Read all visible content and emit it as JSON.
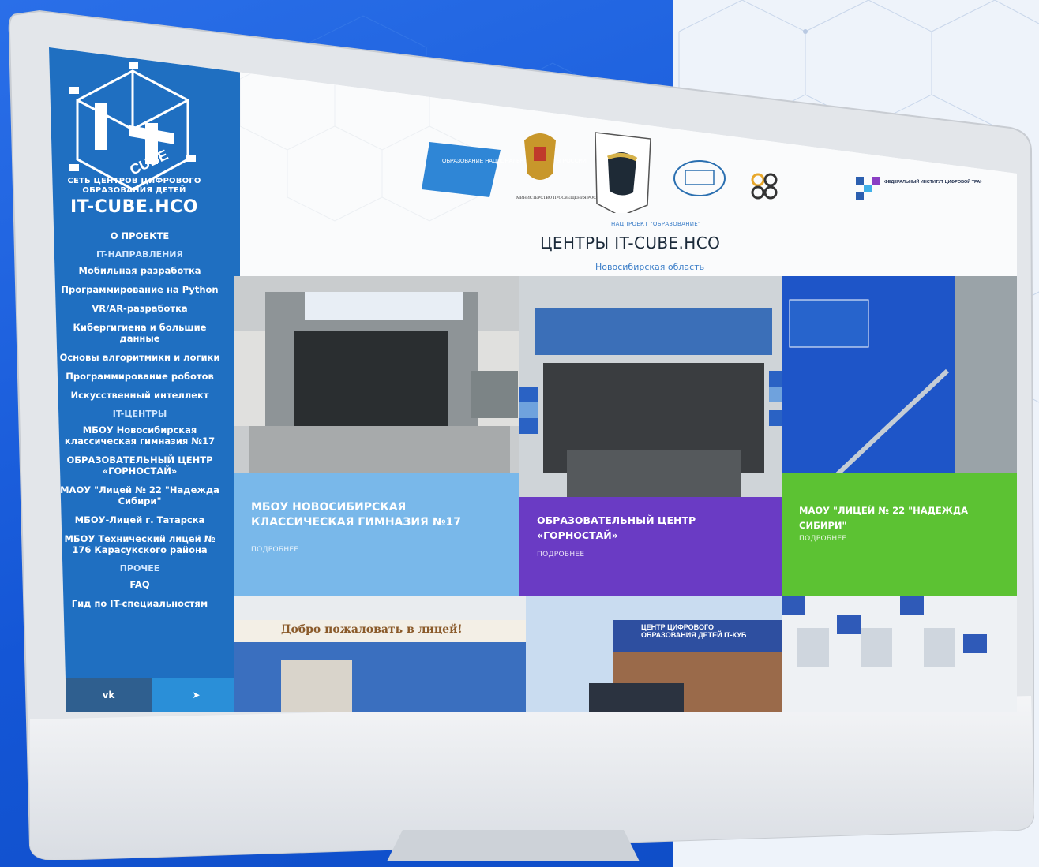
{
  "sidebar": {
    "network_name": "СЕТЬ ЦЕНТРОВ ЦИФРОВОГО ОБРАЗОВАНИЯ ДЕТЕЙ",
    "brand": "IT-CUBE.HCO",
    "nav": [
      {
        "label": "О ПРОЕКТЕ",
        "type": "item"
      },
      {
        "label": "IT-НАПРАВЛЕНИЯ",
        "type": "head"
      },
      {
        "label": "Мобильная разработка",
        "type": "item"
      },
      {
        "label": "Программирование на Python",
        "type": "item"
      },
      {
        "label": "VR/AR-разработка",
        "type": "item"
      },
      {
        "label": "Кибергигиена и большие данные",
        "type": "item"
      },
      {
        "label": "Основы алгоритмики и логики",
        "type": "item"
      },
      {
        "label": "Программирование роботов",
        "type": "item"
      },
      {
        "label": "Искусственный интеллект",
        "type": "item"
      },
      {
        "label": "IT-ЦЕНТРЫ",
        "type": "head"
      },
      {
        "label": "МБОУ Новосибирская классическая гимназия №17",
        "type": "item"
      },
      {
        "label": "ОБРАЗОВАТЕЛЬНЫЙ ЦЕНТР «ГОРНОСТАЙ»",
        "type": "item"
      },
      {
        "label": "МАОУ \"Лицей № 22 \"Надежда Сибири\"",
        "type": "item"
      },
      {
        "label": "МБОУ-Лицей г. Татарска",
        "type": "item"
      },
      {
        "label": "МБОУ Технический лицей № 176 Карасукского района",
        "type": "item"
      },
      {
        "label": "ПРОЧЕЕ",
        "type": "head"
      },
      {
        "label": "FAQ",
        "type": "item"
      },
      {
        "label": "Гид по IT-специальностям",
        "type": "item"
      }
    ],
    "social": {
      "vk": "vk",
      "tg": "➤"
    }
  },
  "header": {
    "national_projects_logo": "ОБРАЗОВАНИЕ НАЦИОНАЛЬНЫЕ ПРОЕКТЫ РОССИИ",
    "ministry_caption": "МИНИСТЕРСТВО ПРОСВЕЩЕНИЯ РОССИЙСКОЙ ФЕДЕРАЦИИ",
    "institute_caption": "ФЕДЕРАЛЬНЫЙ ИНСТИТУТ ЦИФРОВОЙ ТРАНСФОРМАЦИИ В СФЕРЕ ОБРАЗОВАНИЯ",
    "project_note": "НАЦПРОЕКТ \"ОБРАЗОВАНИЕ\"",
    "title": "ЦЕНТРЫ IT-CUBE.HCO",
    "region": "Новосибирская область"
  },
  "cards": [
    {
      "name": "МБОУ НОВОСИБИРСКАЯ КЛАССИЧЕСКАЯ ГИМНАЗИЯ №17",
      "more": "ПОДРОБНЕЕ",
      "color": "#79b8ea"
    },
    {
      "name": "ОБРАЗОВАТЕЛЬНЫЙ ЦЕНТР «ГОРНОСТАЙ»",
      "more": "ПОДРОБНЕЕ",
      "color": "#6a3bc4"
    },
    {
      "name": "МАОУ \"ЛИЦЕЙ № 22 \"НАДЕЖДА СИБИРИ\"",
      "more": "ПОДРОБНЕЕ",
      "color": "#5cc233"
    },
    {
      "banner": "Добро пожаловать в лицей!"
    },
    {
      "banner": "ЦЕНТР ЦИФРОВОГО ОБРАЗОВАНИЯ ДЕТЕЙ IT-КУБ"
    },
    {}
  ],
  "colors": {
    "sidebar": "#1f6fc1",
    "accent": "#1456d6"
  }
}
